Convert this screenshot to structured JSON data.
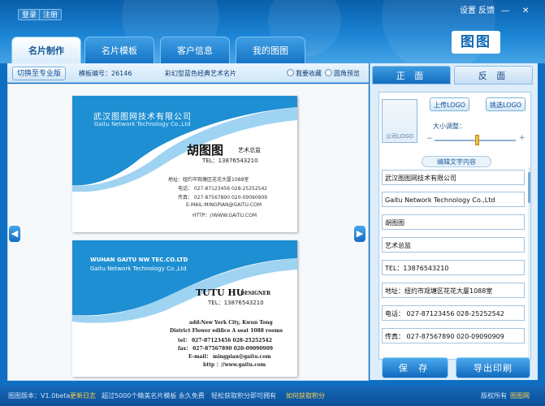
{
  "top": {
    "login": "登录",
    "register": "注册",
    "settings": "设置",
    "feedback": "反馈",
    "minimize": "—",
    "close": "✕",
    "logo_text": "图图"
  },
  "tabs": [
    {
      "label": "名片制作",
      "active": true
    },
    {
      "label": "名片模板",
      "active": false
    },
    {
      "label": "客户信息",
      "active": false
    },
    {
      "label": "我的图图",
      "active": false
    }
  ],
  "infobar": {
    "switch_label": "切换至专业版",
    "template_no": "模板编号：26146",
    "template_name": "彩幻型蓝色经典艺术名片",
    "favorite": "我要收藏",
    "round_preview": "圆角预览"
  },
  "card_front": {
    "company": "武汉图图网技术有限公司",
    "company_en": "Gaitu Network Technology Co.,Ltd",
    "name": "胡图图",
    "title": "艺术总监",
    "tel": "TEL：13876543210",
    "address": "地址：纽约市观塘区花花大厦1088室",
    "phone": "电话：  027-87123456   028-25252542",
    "fax": "传真：  027-87567890   020-09090909",
    "email": "E-MAIL:MINGPIAN@GAITU.COM",
    "http": "HTTP：//WWW.GAITU.COM"
  },
  "card_back": {
    "company": "WUHAN GAITU NW TEC.CO.LTD",
    "company_en": "Gaitu Network Technology Co.,Ltd",
    "name": "TUTU HU",
    "title": "DESIGNER",
    "tel": "TEL：13876543210",
    "address": "add:New York City, Kwun Tong",
    "address2": "District Flower edifice A seat 1088 rooms",
    "tel_line": "tel：  027-87123456   028-25252542",
    "fax": "fax：  027-87567890   020-09090909",
    "email": "E-mail：  mingpian@gaitu.com",
    "http": "http ：//www.gaitu.com"
  },
  "side_tabs": {
    "front": "正 面",
    "back": "反 面"
  },
  "panel": {
    "logo_placeholder": "公司LOGO",
    "upload_logo": "上传LOGO",
    "choose_logo": "挑选LOGO",
    "size_label": "大小调整：",
    "size_value": 0.52,
    "edit_title": "编辑文字内容",
    "fields": [
      "武汉图图网技术有限公司",
      "Gaitu Network Technology Co.,Ltd",
      "胡图图",
      "艺术总监",
      "TEL：13876543210",
      "地址：纽约市观塘区花花大厦1088室",
      "电话：  027-87123456     028-25252542",
      "传真：  027-87567890     020-09090909"
    ]
  },
  "actions": {
    "save": "保 存",
    "export_print": "导出印刷"
  },
  "status": {
    "version": "图图版本：V1.0beta",
    "changelog": "更新日志",
    "promo": "超过5000个精美名片模板 永久免费",
    "points": "轻松获取积分即可拥有",
    "get_points": "如何获取积分",
    "copyright": "版权所有 ",
    "brand": "图图网"
  },
  "colors": {
    "brand_blue": "#0e6fc2",
    "card_blue": "#1e8fd2",
    "link_yellow": "#ffd24a"
  }
}
